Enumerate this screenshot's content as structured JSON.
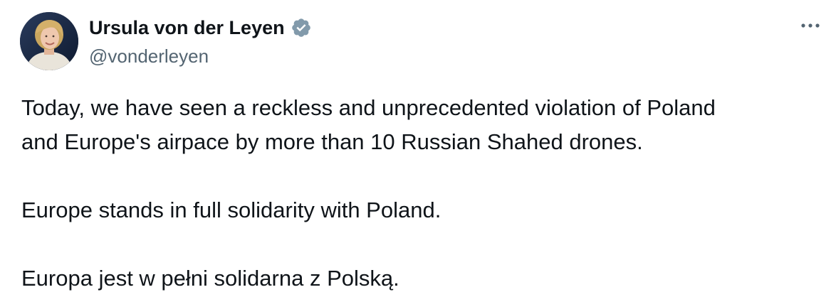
{
  "author": {
    "name": "Ursula von der Leyen",
    "handle": "@vonderleyen",
    "verified_icon": "verified-badge-icon",
    "verified_color": "#829aab"
  },
  "menu": {
    "more_icon": "more-horizontal-icon"
  },
  "tweet": {
    "line1": "Today, we have seen a reckless and unprecedented violation of Poland",
    "line2": "and Europe's airpace by more than 10 Russian Shahed drones.",
    "line3": "Europe stands in full solidarity with Poland.",
    "line4": "Europa jest w pełni solidarna z Polską."
  }
}
